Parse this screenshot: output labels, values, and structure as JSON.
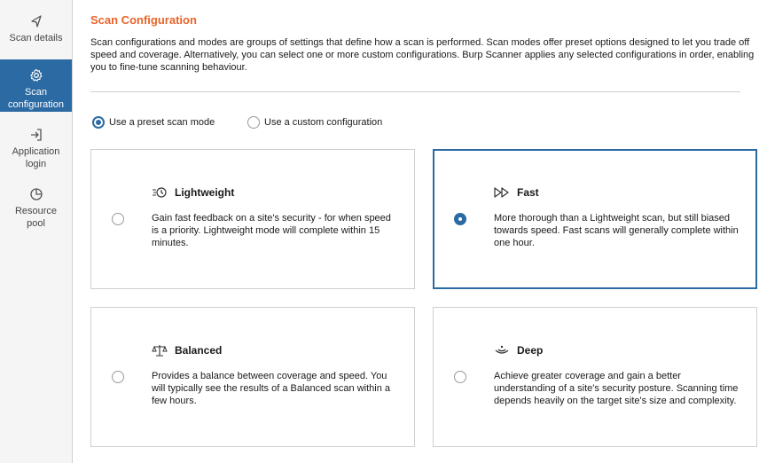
{
  "sidebar": {
    "items": [
      {
        "label": "Scan details",
        "icon": "target-icon",
        "active": false
      },
      {
        "label": "Scan\nconfiguration",
        "icon": "gear-icon",
        "active": true
      },
      {
        "label": "Application\nlogin",
        "icon": "login-icon",
        "active": false
      },
      {
        "label": "Resource\npool",
        "icon": "pie-chart-icon",
        "active": false
      }
    ]
  },
  "main": {
    "title": "Scan Configuration",
    "description": "Scan configurations and modes are groups of settings that define how a scan is performed. Scan modes offer preset options designed to let you trade off speed and coverage. Alternatively, you can select one or more custom configurations. Burp Scanner applies any selected configurations in order, enabling you to fine-tune scanning behaviour.",
    "mode_options": [
      {
        "label": "Use a preset scan mode",
        "selected": true
      },
      {
        "label": "Use a custom configuration",
        "selected": false
      }
    ],
    "cards": [
      {
        "title": "Lightweight",
        "icon": "lightweight-clock-icon",
        "selected": false,
        "text": "Gain fast feedback on a site's security - for when speed is a priority. Lightweight mode will complete within 15 minutes."
      },
      {
        "title": "Fast",
        "icon": "fast-forward-icon",
        "selected": true,
        "text": "More thorough than a Lightweight scan, but still biased towards speed. Fast scans will generally complete within one hour."
      },
      {
        "title": "Balanced",
        "icon": "scales-icon",
        "selected": false,
        "text": "Provides a balance between coverage and speed. You will typically see the results of a Balanced scan within a few hours."
      },
      {
        "title": "Deep",
        "icon": "deep-signal-icon",
        "selected": false,
        "text": "Achieve greater coverage and gain a better understanding of a site's security posture. Scanning time depends heavily on the target site's size and complexity."
      }
    ]
  },
  "colors": {
    "accent": "#2c6aa3",
    "title": "#e8642a"
  }
}
